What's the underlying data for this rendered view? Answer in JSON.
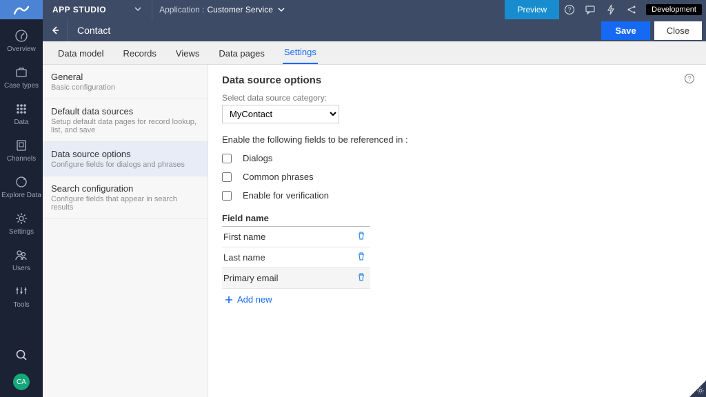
{
  "topbar": {
    "studio_title": "APP STUDIO",
    "app_label_prefix": "Application :",
    "app_name": "Customer Service",
    "preview": "Preview",
    "dev_badge": "Development"
  },
  "leftnav": {
    "items": [
      {
        "label": "Overview"
      },
      {
        "label": "Case types"
      },
      {
        "label": "Data"
      },
      {
        "label": "Channels"
      },
      {
        "label": "Explore Data"
      },
      {
        "label": "Settings"
      },
      {
        "label": "Users"
      },
      {
        "label": "Tools"
      }
    ],
    "avatar": "CA"
  },
  "subheader": {
    "page_title": "Contact",
    "save": "Save",
    "close": "Close"
  },
  "tabs": [
    {
      "label": "Data model"
    },
    {
      "label": "Records"
    },
    {
      "label": "Views"
    },
    {
      "label": "Data pages"
    },
    {
      "label": "Settings",
      "active": true
    }
  ],
  "settings_nav": [
    {
      "title": "General",
      "sub": "Basic configuration"
    },
    {
      "title": "Default data sources",
      "sub": "Setup default data pages for record lookup, list, and save"
    },
    {
      "title": "Data source options",
      "sub": "Configure fields for dialogs and phrases",
      "active": true
    },
    {
      "title": "Search configuration",
      "sub": "Configure fields that appear in search results"
    }
  ],
  "panel": {
    "heading": "Data source options",
    "category_label": "Select data source category:",
    "category_value": "MyContact",
    "enable_intro": "Enable the following fields to be referenced in :",
    "checkboxes": [
      {
        "label": "Dialogs"
      },
      {
        "label": "Common phrases"
      },
      {
        "label": "Enable for verification"
      }
    ],
    "table_header": "Field name",
    "rows": [
      {
        "label": "First name"
      },
      {
        "label": "Last name"
      },
      {
        "label": "Primary email"
      }
    ],
    "add_new": "Add new"
  }
}
